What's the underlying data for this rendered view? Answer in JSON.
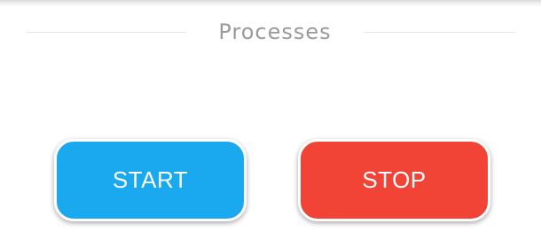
{
  "section": {
    "title": "Processes"
  },
  "buttons": {
    "start_label": "START",
    "stop_label": "STOP"
  },
  "colors": {
    "start": "#1aa8ee",
    "stop": "#f14336",
    "title_text": "#9a9a9a",
    "divider": "#e6e6e6"
  }
}
